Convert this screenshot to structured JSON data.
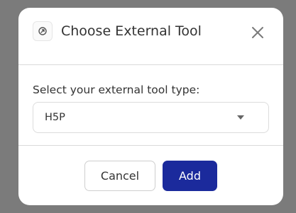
{
  "dialog": {
    "title": "Choose External Tool",
    "title_icon": "external-tool-icon",
    "close_icon": "close-icon"
  },
  "form": {
    "label": "Select your external tool type:",
    "selected_value": "H5P",
    "dropdown_icon": "chevron-down-icon"
  },
  "actions": {
    "cancel_label": "Cancel",
    "add_label": "Add"
  },
  "colors": {
    "overlay": "#7b7b7b",
    "primary": "#1b2a9c",
    "text": "#333333"
  }
}
